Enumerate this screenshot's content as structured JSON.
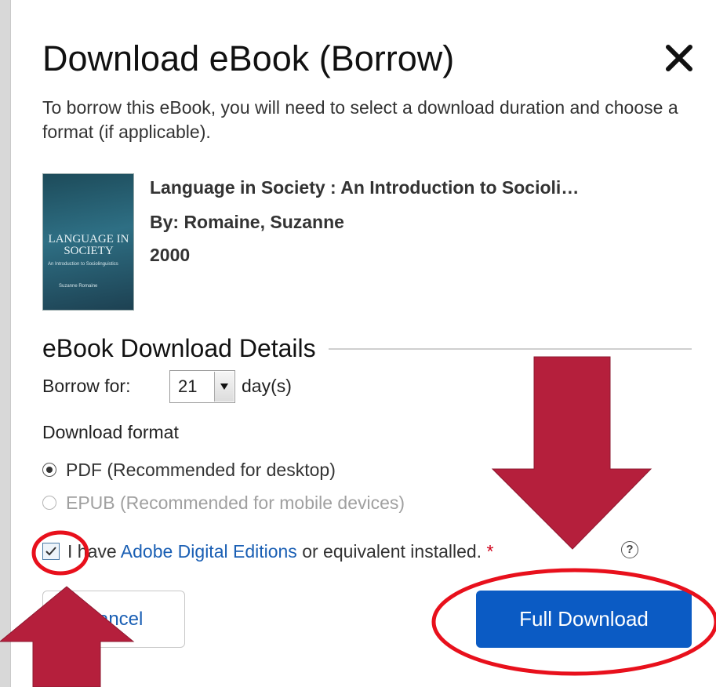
{
  "dialog": {
    "title": "Download eBook (Borrow)",
    "intro": "To borrow this eBook, you will need to select a download duration and choose a format (if applicable).",
    "close_icon": "close-icon"
  },
  "book": {
    "title": "Language in Society : An Introduction to Socioli…",
    "author": "By: Romaine, Suzanne",
    "year": "2000",
    "cover": {
      "title": "LANGUAGE IN SOCIETY",
      "subtitle": "An Introduction to Sociolinguistics",
      "author": "Suzanne Romaine"
    }
  },
  "details": {
    "section_title": "eBook Download Details",
    "borrow_label": "Borrow for:",
    "borrow_value": "21",
    "borrow_unit": "day(s)",
    "format_label": "Download format",
    "formats": [
      {
        "label": "PDF (Recommended for desktop)",
        "selected": true,
        "enabled": true
      },
      {
        "label": "EPUB (Recommended for mobile devices)",
        "selected": false,
        "enabled": false
      }
    ],
    "confirm_prefix": "I have ",
    "confirm_link": "Adobe Digital Editions",
    "confirm_suffix": " or equivalent installed.",
    "confirm_required": "*",
    "confirm_checked": true,
    "help_icon": "?"
  },
  "actions": {
    "cancel": "Cancel",
    "download": "Full Download"
  },
  "colors": {
    "primary": "#0b5bc4",
    "link": "#1a5fb4",
    "annotation_arrow": "#b51f3c",
    "annotation_circle": "#e8101c"
  }
}
